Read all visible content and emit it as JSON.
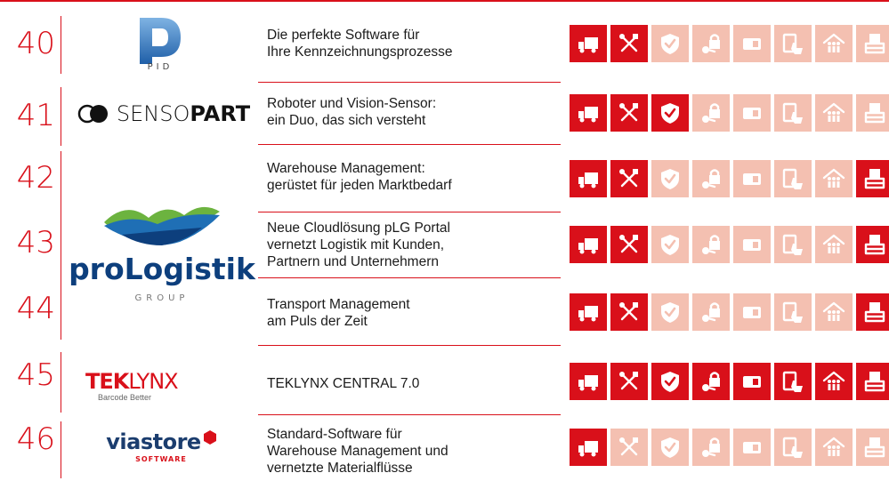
{
  "colors": {
    "accent": "#d9101a",
    "inactive": "#f4c0b1"
  },
  "icon_legend": [
    "truck-icon",
    "tools-icon",
    "shield-icon",
    "lock-key-icon",
    "sim-card-icon",
    "touch-device-icon",
    "people-house-icon",
    "inbox-tray-icon"
  ],
  "entries": [
    {
      "number": "40",
      "logo": {
        "name": "PID",
        "text": "PID"
      },
      "description": [
        "Die perfekte Software für",
        "Ihre Kennzeichnungsprozesse"
      ],
      "active": [
        true,
        true,
        false,
        false,
        false,
        false,
        false,
        false
      ]
    },
    {
      "number": "41",
      "logo": {
        "name": "SensoPart",
        "text_light": "SENSO",
        "text_bold": "PART"
      },
      "description": [
        "Roboter und Vision-Sensor:",
        "ein Duo, das sich versteht"
      ],
      "active": [
        true,
        true,
        true,
        false,
        false,
        false,
        false,
        false
      ]
    },
    {
      "number": "42",
      "logo": {
        "name": "proLogistik",
        "text": "proLogistik",
        "sub": "GROUP"
      },
      "description": [
        "Warehouse Management:",
        "gerüstet für jeden Marktbedarf"
      ],
      "active": [
        true,
        true,
        false,
        false,
        false,
        false,
        false,
        true
      ]
    },
    {
      "number": "43",
      "description": [
        "Neue Cloudlösung pLG Portal",
        "vernetzt Logistik mit Kunden,",
        "Partnern und Unternehmern"
      ],
      "active": [
        true,
        true,
        false,
        false,
        false,
        false,
        false,
        true
      ]
    },
    {
      "number": "44",
      "description": [
        "Transport Management",
        "am Puls der Zeit"
      ],
      "active": [
        true,
        true,
        false,
        false,
        false,
        false,
        false,
        true
      ]
    },
    {
      "number": "45",
      "logo": {
        "name": "TEKLYNX",
        "text_a": "TEK",
        "text_b": "LYNX",
        "sub": "Barcode Better"
      },
      "description": [
        "TEKLYNX CENTRAL 7.0"
      ],
      "active": [
        true,
        true,
        true,
        true,
        true,
        true,
        true,
        true
      ]
    },
    {
      "number": "46",
      "logo": {
        "name": "viastore",
        "text": "viastore",
        "sub": "SOFTWARE"
      },
      "description": [
        "Standard-Software für",
        "Warehouse Management und",
        "vernetzte Materialflüsse"
      ],
      "active": [
        true,
        false,
        false,
        false,
        false,
        false,
        false,
        false
      ]
    }
  ]
}
